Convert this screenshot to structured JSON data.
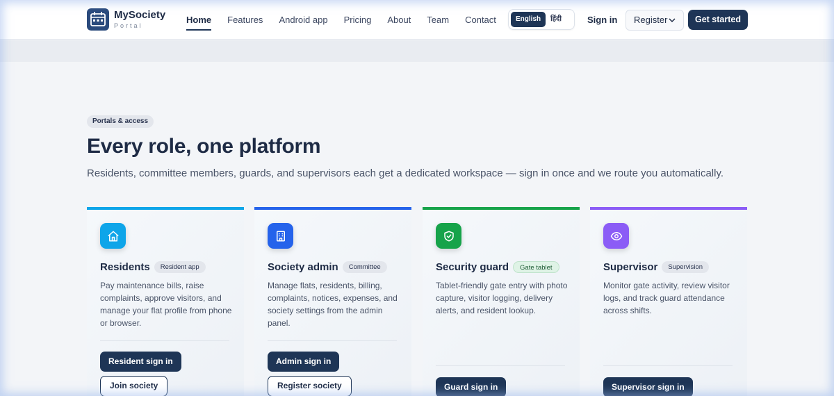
{
  "brand": {
    "name": "MySociety",
    "subtitle": "Portal"
  },
  "nav": {
    "items": [
      "Home",
      "Features",
      "Android app",
      "Pricing",
      "About",
      "Team",
      "Contact"
    ],
    "active": "Home"
  },
  "language": {
    "options": [
      "English",
      "हिंदी"
    ],
    "selected": "English"
  },
  "header_actions": {
    "signin": "Sign in",
    "register": "Register",
    "cta": "Get started"
  },
  "section": {
    "eyebrow": "Portals & access",
    "title": "Every role, one platform",
    "subtitle": "Residents, committee members, guards, and supervisors each get a dedicated workspace — sign in once and we route you automatically."
  },
  "cards": [
    {
      "title": "Residents",
      "badge": "Resident app",
      "icon": "home-icon",
      "accent": "#0ea5e9",
      "description": "Pay maintenance bills, raise complaints, approve visitors, and manage your flat profile from phone or browser.",
      "primary": "Resident sign in",
      "secondary": "Join society"
    },
    {
      "title": "Society admin",
      "badge": "Committee",
      "icon": "building-icon",
      "accent": "#2563eb",
      "description": "Manage flats, residents, billing, complaints, notices, expenses, and society settings from the admin panel.",
      "primary": "Admin sign in",
      "secondary": "Register society"
    },
    {
      "title": "Security guard",
      "badge": "Gate tablet",
      "icon": "shield-check-icon",
      "accent": "#16a34a",
      "description": "Tablet-friendly gate entry with photo capture, visitor logging, delivery alerts, and resident lookup.",
      "primary": "Guard sign in"
    },
    {
      "title": "Supervisor",
      "badge": "Supervision",
      "icon": "eye-icon",
      "accent": "#8b5cf6",
      "description": "Monitor gate activity, review visitor logs, and track guard attendance across shifts.",
      "primary": "Supervisor sign in"
    }
  ]
}
